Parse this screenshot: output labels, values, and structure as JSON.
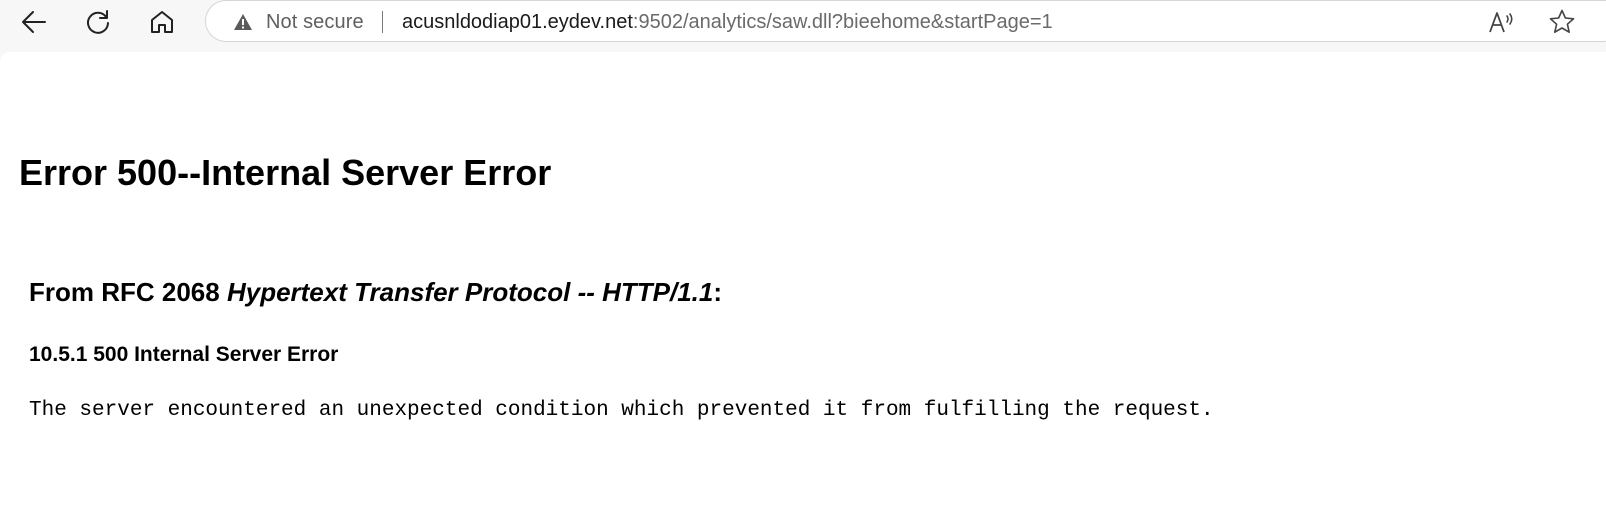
{
  "toolbar": {
    "back_icon": "back-arrow-icon",
    "reload_icon": "reload-icon",
    "home_icon": "home-icon",
    "security": {
      "icon": "warning-triangle-icon",
      "label": "Not secure"
    },
    "url": {
      "host": "acusnldodiap01.eydev.net",
      "rest": ":9502/analytics/saw.dll?bieehome&startPage=1"
    },
    "read_aloud_icon": "read-aloud-icon",
    "favorite_icon": "star-icon"
  },
  "page": {
    "title": "Error 500--Internal Server Error",
    "rfc_prefix": "From RFC 2068 ",
    "rfc_italic": "Hypertext Transfer Protocol -- HTTP/1.1",
    "rfc_suffix": ":",
    "section_heading": "10.5.1 500 Internal Server Error",
    "body": "The server encountered an unexpected condition which prevented it from fulfilling the request."
  },
  "colors": {
    "chrome_background": "#f7f7f7",
    "page_background": "#ffffff",
    "url_host": "#1a1a1a",
    "url_rest": "#6a6a6a",
    "security_label": "#5f5f5f"
  }
}
